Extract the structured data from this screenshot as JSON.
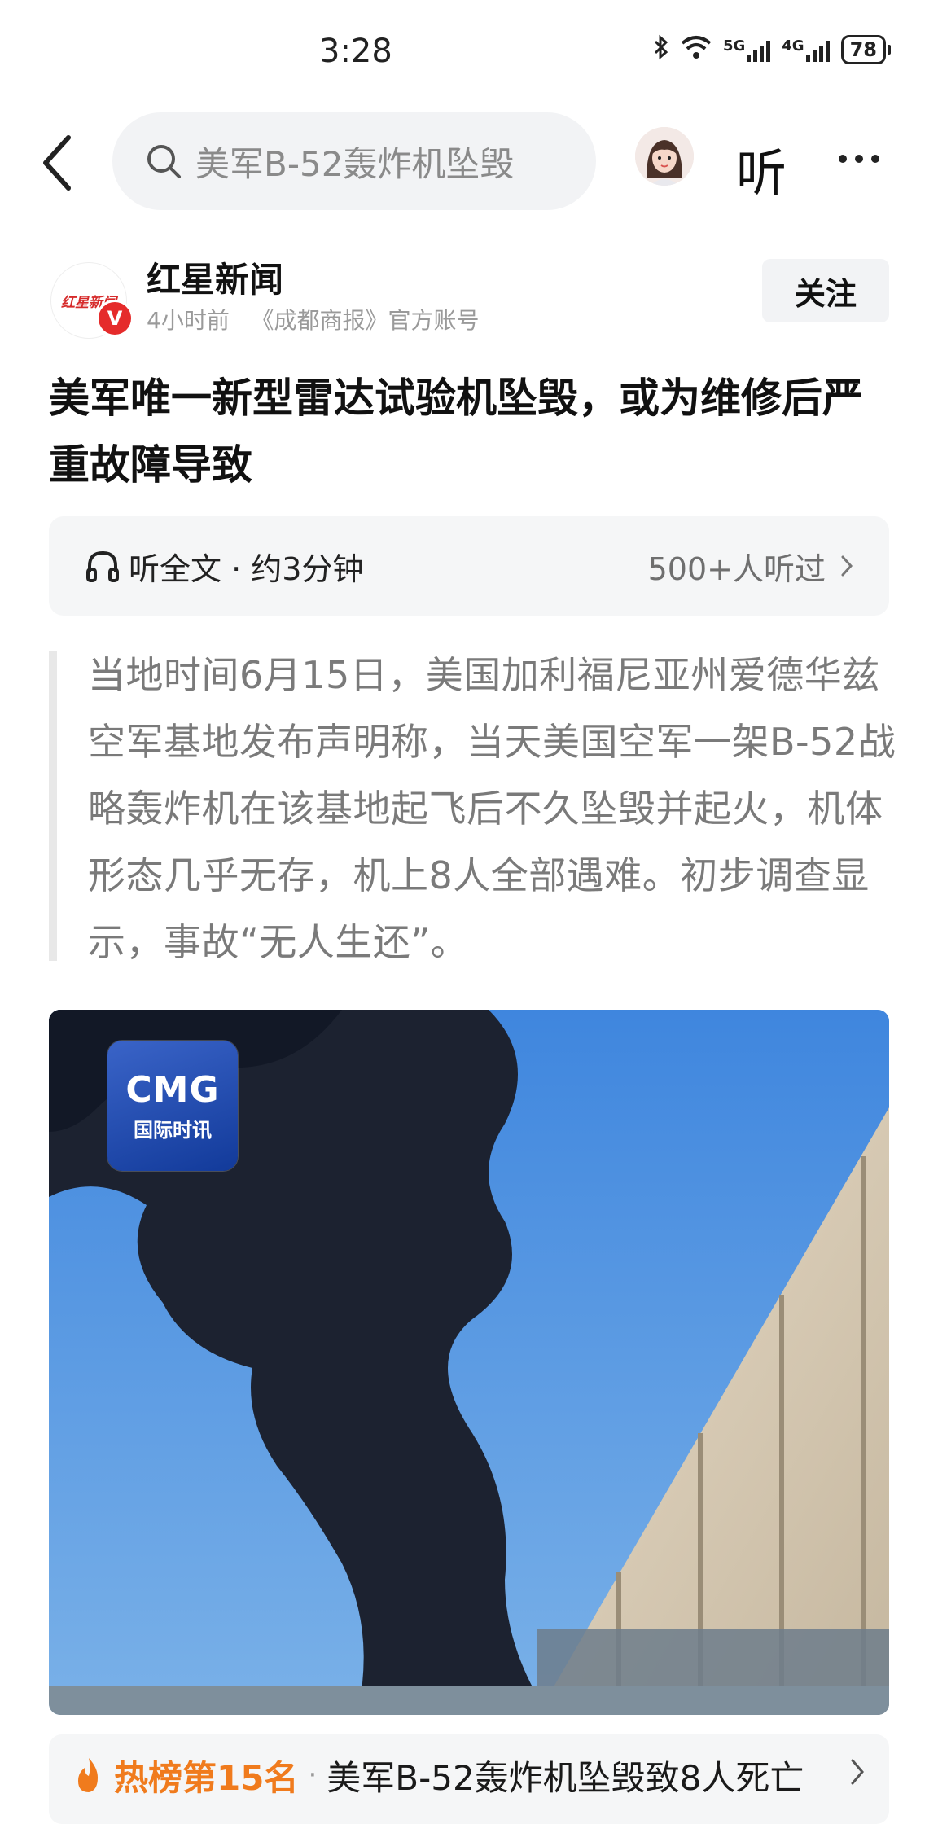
{
  "status_bar": {
    "time": "3:28",
    "network_1": "5G",
    "network_2": "4G",
    "battery": "78"
  },
  "top_bar": {
    "search_text": "美军B-52轰炸机坠毁",
    "listen_label": "听"
  },
  "author": {
    "name": "红星新闻",
    "time_ago": "4小时前",
    "source": "《成都商报》官方账号",
    "verified_badge": "V",
    "logo_text": "红星新闻",
    "follow_label": "关注"
  },
  "article": {
    "title": "美军唯一新型雷达试验机坠毁，或为维修后严重故障导致",
    "audio": {
      "label": "听全文 · 约3分钟",
      "listeners": "500+人听过"
    },
    "quote": "当地时间6月15日，美国加利福尼亚州爱德华兹空军基地发布声明称，当天美国空军一架B-52战略轰炸机在该基地起飞后不久坠毁并起火，机体形态几乎无存，机上8人全部遇难。初步调查显示，事故“无人生还”。",
    "image": {
      "logo_main": "CMG",
      "logo_sub": "国际时讯"
    }
  },
  "hot_rank": {
    "rank_label": "热榜第15名",
    "separator": "·",
    "title": "美军B-52轰炸机坠毁致8人死亡"
  },
  "colors": {
    "accent_orange": "#f07b1d",
    "verified_red": "#e52b2b",
    "sky_blue": "#5a95d8",
    "smoke": "#1c2230"
  }
}
